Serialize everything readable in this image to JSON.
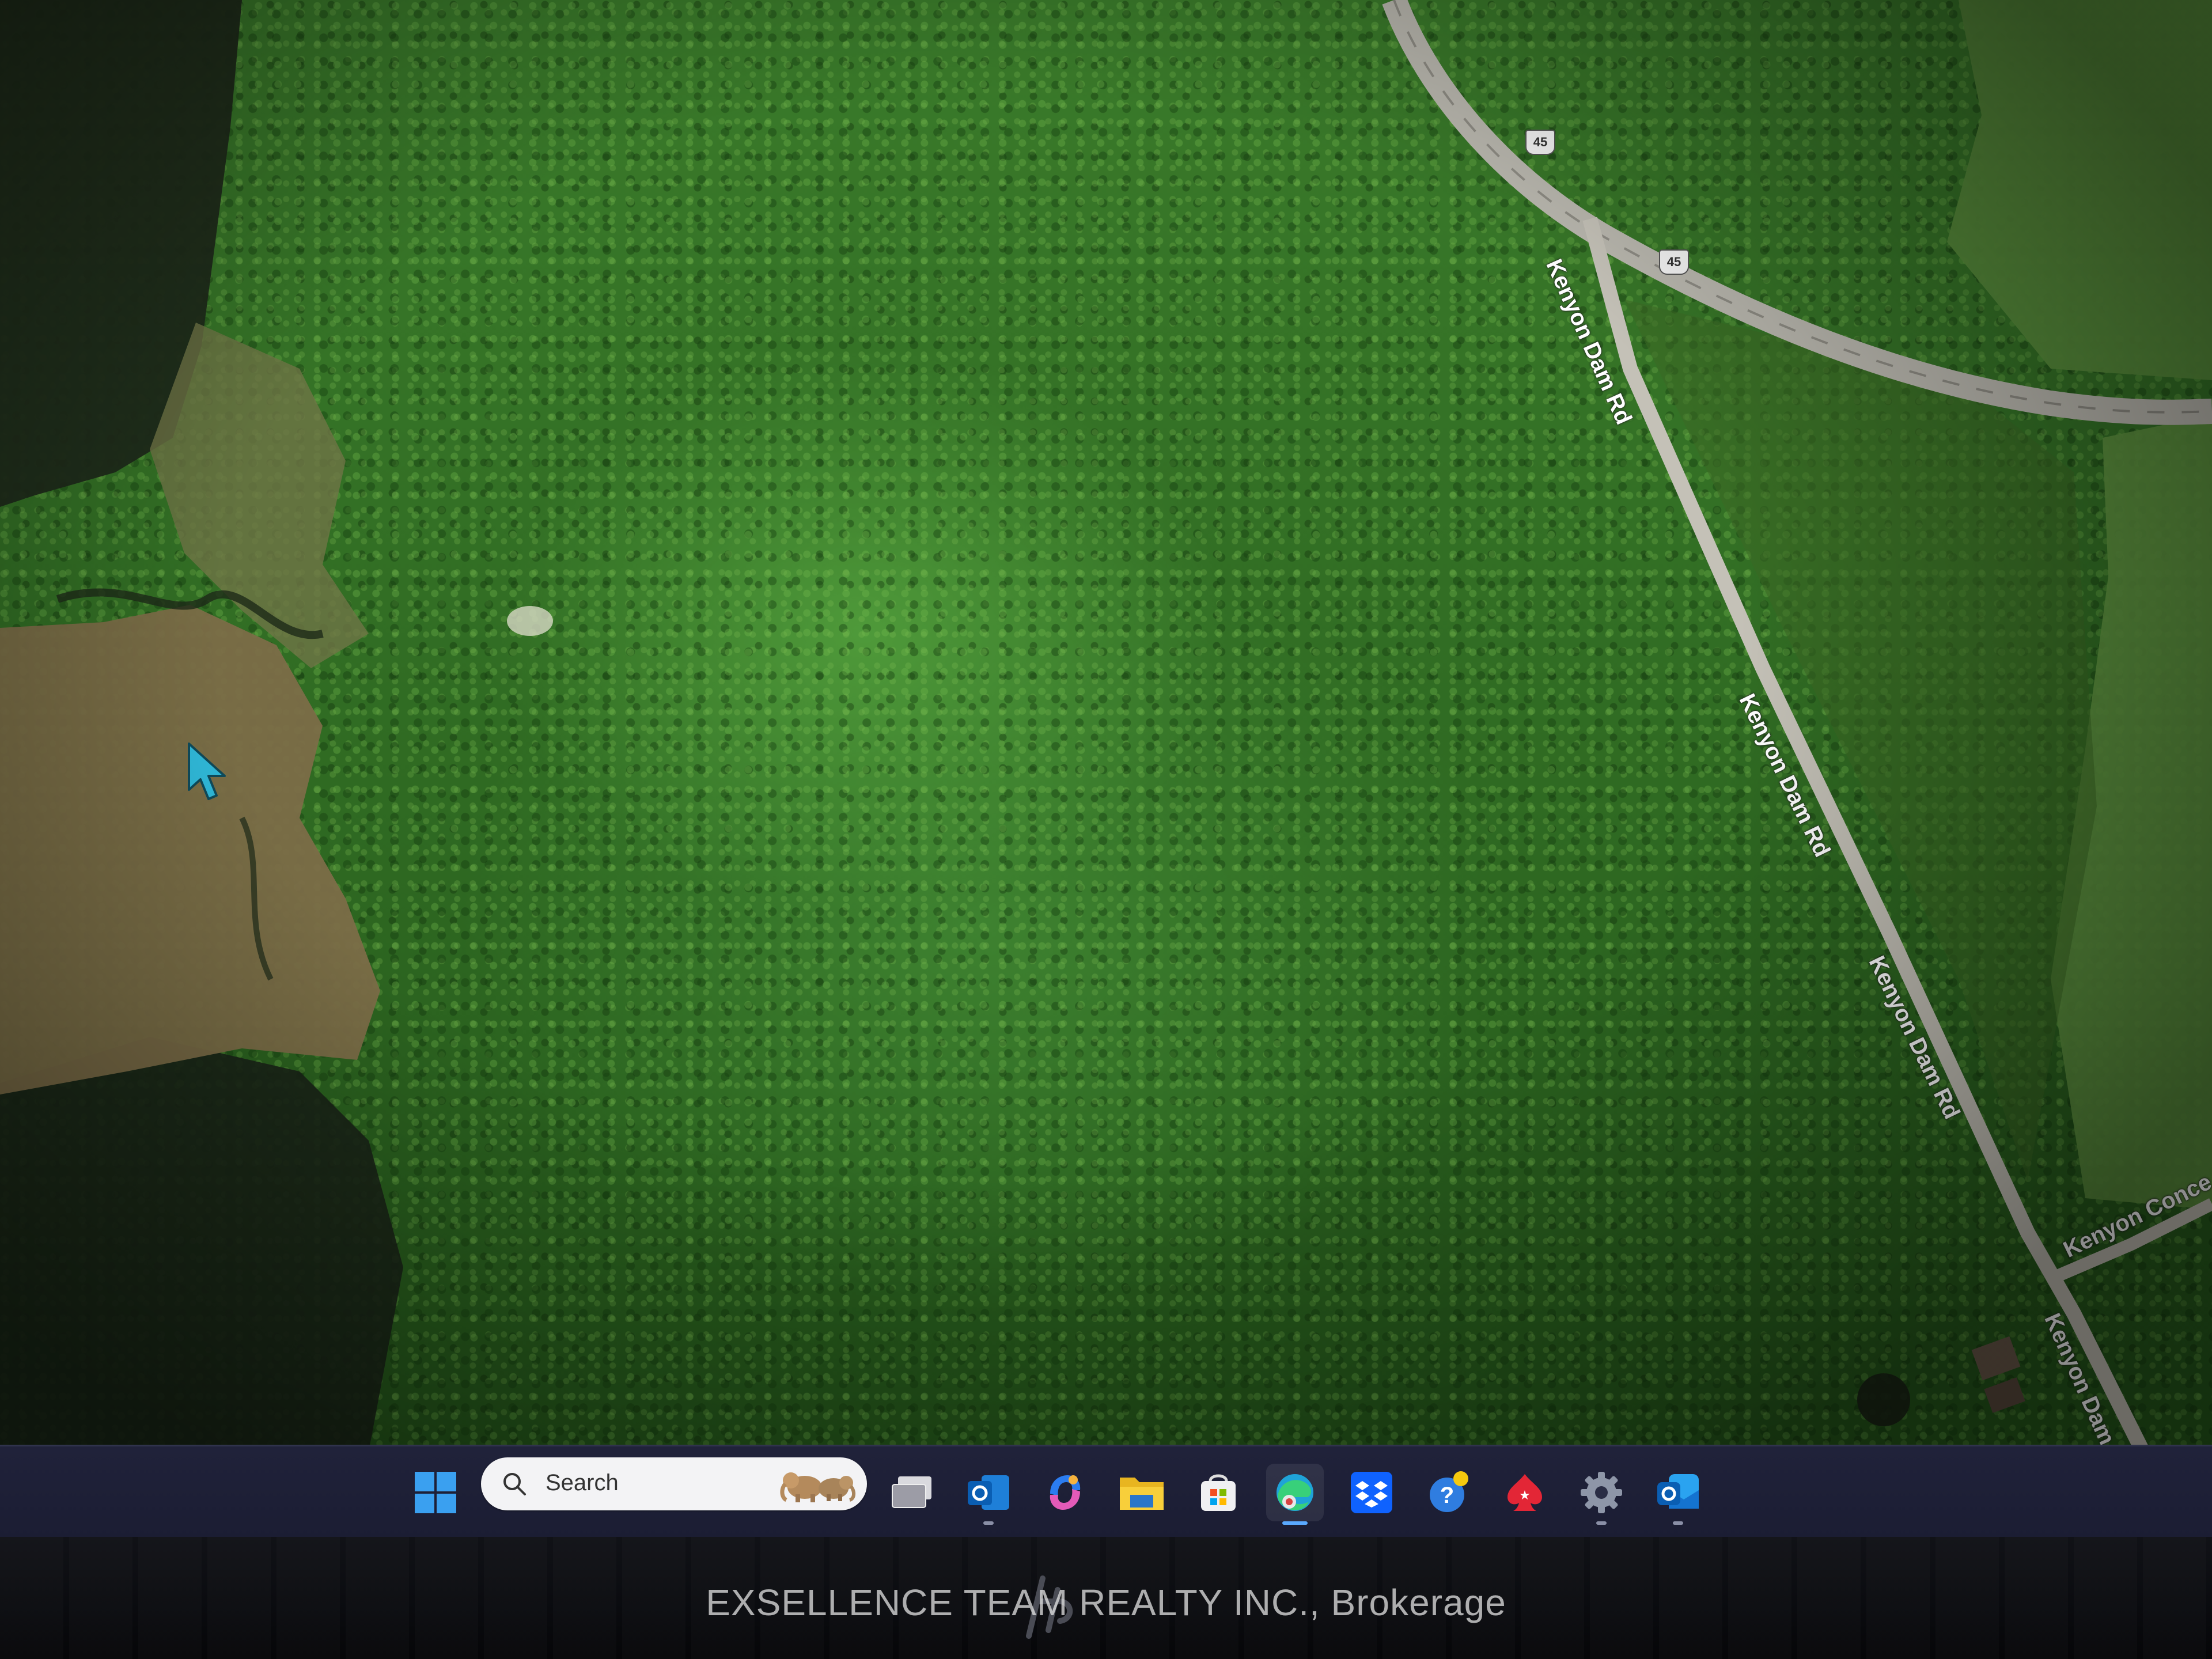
{
  "map": {
    "roads": [
      {
        "name": "Kenyon Dam Rd"
      },
      {
        "name": "Kenyon Dam Rd"
      },
      {
        "name": "Kenyon Dam Rd"
      },
      {
        "name": "Kenyon Dam Rd"
      },
      {
        "name": "Kenyon Conce"
      }
    ],
    "highway_shield": "45",
    "colors": {
      "forest": "#3a7a2a",
      "wetland": "#7a6a45",
      "water": "#1e2a1c",
      "road": "#c9c6bd",
      "field": "#5f9440"
    }
  },
  "cursor": {
    "icon": "cursor-arrow-icon",
    "color": "#2fb8d8"
  },
  "taskbar": {
    "search": {
      "placeholder": "Search"
    },
    "apps": [
      {
        "name": "start",
        "icon": "windows-start-icon"
      },
      {
        "name": "task-view",
        "icon": "task-view-icon"
      },
      {
        "name": "outlook",
        "icon": "outlook-icon"
      },
      {
        "name": "copilot",
        "icon": "copilot-icon"
      },
      {
        "name": "file-explorer",
        "icon": "folder-icon"
      },
      {
        "name": "store",
        "icon": "store-icon"
      },
      {
        "name": "edge",
        "icon": "edge-icon",
        "active": true
      },
      {
        "name": "dropbox",
        "icon": "dropbox-icon"
      },
      {
        "name": "help",
        "icon": "help-icon"
      },
      {
        "name": "solitaire",
        "icon": "spade-icon"
      },
      {
        "name": "settings",
        "icon": "gear-icon"
      },
      {
        "name": "outlook-new",
        "icon": "outlook-new-icon"
      }
    ]
  },
  "watermark": "EXSELLENCE TEAM REALTY INC., Brokerage"
}
